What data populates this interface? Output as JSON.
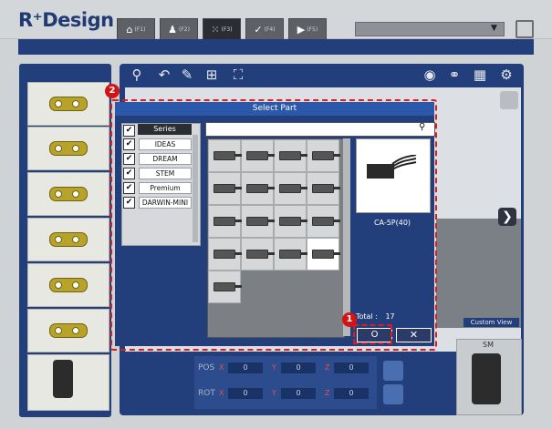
{
  "app": {
    "logo": "R⁺Design"
  },
  "nav_tabs": [
    {
      "icon": "home-icon",
      "sub": "(F1)"
    },
    {
      "icon": "user-icon",
      "sub": "(F2)"
    },
    {
      "icon": "grid-icon",
      "sub": "(F3)"
    },
    {
      "icon": "check-icon",
      "sub": "(F4)"
    },
    {
      "icon": "play-icon",
      "sub": "(F5)"
    }
  ],
  "dialog": {
    "title": "Select Part",
    "series_header": "Series",
    "series": [
      "IDEAS",
      "DREAM",
      "STEM",
      "Premium",
      "DARWIN-MINI"
    ],
    "search_placeholder": "",
    "preview_label": "CA-5P(40)",
    "total_label": "Total :",
    "total_value": "17",
    "ok_label": "O",
    "cancel_label": "✕"
  },
  "viewport": {
    "custom_view_label": "Custom View"
  },
  "transform": {
    "pos_label": "POS",
    "rot_label": "ROT",
    "axes": [
      "X",
      "Y",
      "Z"
    ],
    "pos_values": [
      "0",
      "0",
      "0"
    ],
    "rot_values": [
      "0",
      "0",
      "0"
    ]
  },
  "sm_label": "SM",
  "annotations": {
    "badge1": "1",
    "badge2": "2",
    "highlight_color": "#e01b1b"
  }
}
